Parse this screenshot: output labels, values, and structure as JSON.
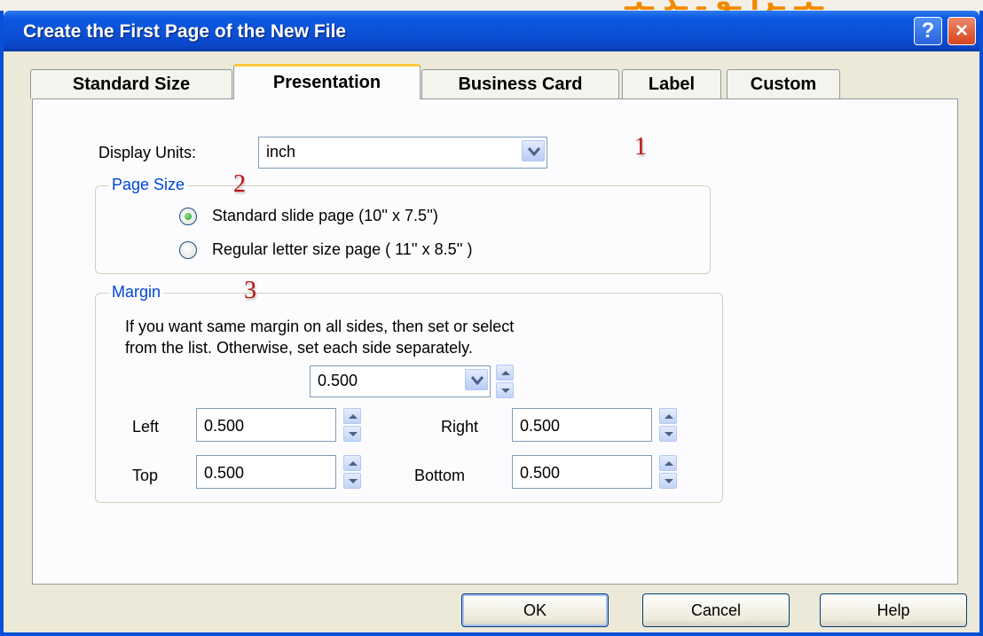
{
  "window": {
    "title": "Create the First Page of the New File",
    "help": "?",
    "close": "×"
  },
  "tabs": [
    {
      "label": "Standard Size"
    },
    {
      "label": "Presentation"
    },
    {
      "label": "Business Card"
    },
    {
      "label": "Label"
    },
    {
      "label": "Custom"
    }
  ],
  "display_units": {
    "label": "Display Units:",
    "value": "inch"
  },
  "page_size": {
    "legend": "Page Size",
    "options": [
      {
        "label": "Standard slide page (10'' x 7.5'')",
        "checked": true
      },
      {
        "label": "Regular letter size page ( 11'' x 8.5'' )",
        "checked": false
      }
    ]
  },
  "margin": {
    "legend": "Margin",
    "description_line1": "If you want same margin on all sides, then set or select",
    "description_line2": "from the list.  Otherwise, set each side separately.",
    "all_sides_value": "0.500",
    "left_label": "Left",
    "left_value": "0.500",
    "right_label": "Right",
    "right_value": "0.500",
    "top_label": "Top",
    "top_value": "0.500",
    "bottom_label": "Bottom",
    "bottom_value": "0.500"
  },
  "annotations": {
    "one": "1",
    "two": "2",
    "three": "3"
  },
  "buttons": {
    "ok": "OK",
    "cancel": "Cancel",
    "help": "Help"
  },
  "colors": {
    "titlebar": "#0b4fd4",
    "active_tab_accent": "#ffc83c",
    "group_legend": "#0046d5",
    "annotation": "#c01010"
  }
}
